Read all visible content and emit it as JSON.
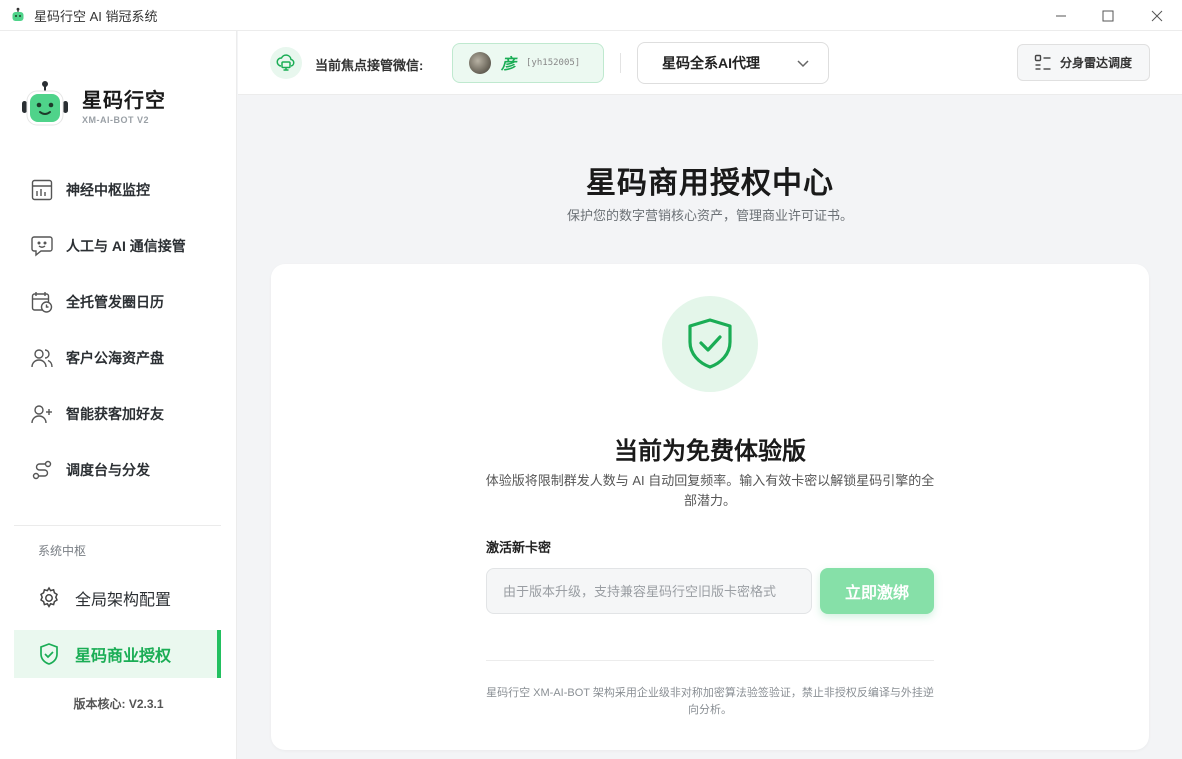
{
  "window": {
    "title": "星码行空 AI 销冠系统"
  },
  "brand": {
    "name": "星码行空",
    "subtitle": "XM-AI-BOT V2"
  },
  "sidebar": {
    "items": [
      {
        "label": "神经中枢监控",
        "icon": "dashboard-monitor-icon"
      },
      {
        "label": "人工与 AI 通信接管",
        "icon": "chat-bot-icon"
      },
      {
        "label": "全托管发圈日历",
        "icon": "calendar-clock-icon"
      },
      {
        "label": "客户公海资产盘",
        "icon": "users-icon"
      },
      {
        "label": "智能获客加好友",
        "icon": "user-plus-icon"
      },
      {
        "label": "调度台与分发",
        "icon": "route-icon"
      }
    ],
    "section_label": "系统中枢",
    "system_items": [
      {
        "label": "全局架构配置",
        "icon": "gear-icon",
        "active": false
      },
      {
        "label": "星码商业授权",
        "icon": "shield-check-icon",
        "active": true
      }
    ],
    "version": "版本核心: V2.3.1"
  },
  "header": {
    "focus_label": "当前焦点接管微信:",
    "account": {
      "name": "彦",
      "id": "[yh152005]"
    },
    "agent_select": {
      "value": "星码全系AI代理"
    },
    "radar_button": "分身雷达调度"
  },
  "main": {
    "title": "星码商用授权中心",
    "subtitle": "保护您的数字营销核心资产，管理商业许可证书。",
    "card": {
      "plan_title": "当前为免费体验版",
      "plan_desc": "体验版将限制群发人数与 AI 自动回复频率。输入有效卡密以解锁星码引擎的全部潜力。",
      "field_label": "激活新卡密",
      "input_placeholder": "由于版本升级，支持兼容星码行空旧版卡密格式",
      "input_value": "",
      "activate_label": "立即激绑",
      "footnote": "星码行空 XM-AI-BOT 架构采用企业级非对称加密算法验签验证，禁止非授权反编译与外挂逆向分析。"
    }
  },
  "colors": {
    "accent": "#22c060",
    "accent_light": "#e4f6ea",
    "button_disabled": "#86e0a8"
  }
}
